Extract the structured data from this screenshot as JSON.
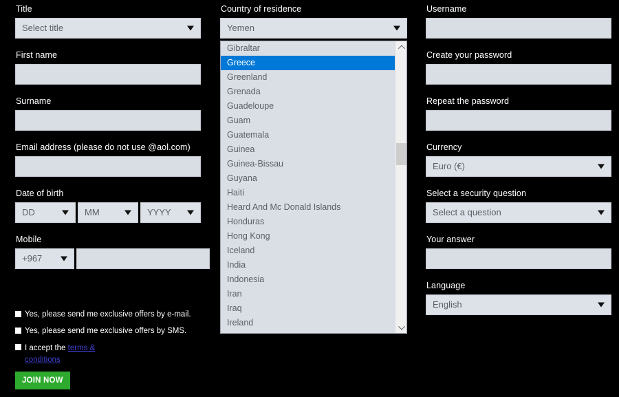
{
  "form": {
    "left": {
      "title": {
        "label": "Title",
        "value": "Select title"
      },
      "first_name": {
        "label": "First name",
        "value": "",
        "placeholder": ""
      },
      "surname": {
        "label": "Surname",
        "value": "",
        "placeholder": ""
      },
      "email": {
        "label": "Email address (please do not use @aol.com)",
        "value": "",
        "placeholder": ""
      },
      "dob": {
        "label": "Date of birth",
        "day": "DD",
        "month": "MM",
        "year": "YYYY"
      },
      "mobile": {
        "label": "Mobile",
        "code": "+967",
        "number": "",
        "placeholder": ""
      }
    },
    "middle": {
      "country": {
        "label": "Country of residence",
        "value": "Yemen",
        "open": true,
        "highlighted": "Greece",
        "options": [
          "Gibraltar",
          "Greece",
          "Greenland",
          "Grenada",
          "Guadeloupe",
          "Guam",
          "Guatemala",
          "Guinea",
          "Guinea-Bissau",
          "Guyana",
          "Haiti",
          "Heard And Mc Donald Islands",
          "Honduras",
          "Hong Kong",
          "Iceland",
          "India",
          "Indonesia",
          "Iran",
          "Iraq",
          "Ireland"
        ]
      }
    },
    "right": {
      "username": {
        "label": "Username",
        "value": "",
        "placeholder": ""
      },
      "password": {
        "label": "Create your password",
        "value": "",
        "placeholder": ""
      },
      "password_repeat": {
        "label": "Repeat the password",
        "value": "",
        "placeholder": ""
      },
      "currency": {
        "label": "Currency",
        "value": "Euro (€)"
      },
      "security_question": {
        "label": "Select a security question",
        "value": "Select a question"
      },
      "answer": {
        "label": "Your answer",
        "value": "",
        "placeholder": ""
      },
      "language": {
        "label": "Language",
        "value": "English"
      }
    },
    "consents": {
      "email_offers": "Yes, please send me exclusive offers by e-mail.",
      "sms_offers": "Yes, please send me exclusive offers by SMS.",
      "terms_prefix": "I accept the ",
      "terms_link_part1": "terms &",
      "terms_link_part2": "conditions"
    },
    "submit": {
      "label": "JOIN NOW"
    }
  },
  "colors": {
    "background": "#000000",
    "input_bg": "#d9dde4",
    "select_bg": "#dde1e8",
    "label_text": "#ffffff",
    "highlight": "#0078d7",
    "link": "#3f3fd0",
    "submit_bg": "#2eaa2e"
  },
  "icons": {
    "caret": "chevron-down-icon",
    "scroll_up": "scroll-up-arrow-icon",
    "scroll_down": "scroll-down-arrow-icon"
  }
}
